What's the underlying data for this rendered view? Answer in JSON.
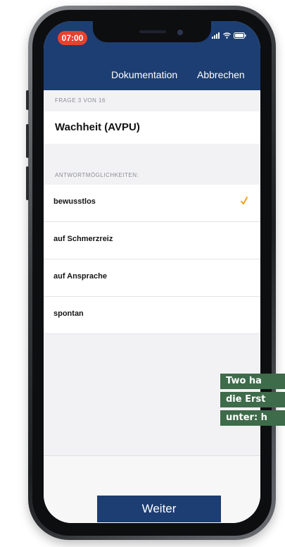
{
  "status_bar": {
    "time": "07:00",
    "icons": "ıll ᯤ ▬"
  },
  "nav": {
    "title": "Dokumentation",
    "cancel": "Abbrechen"
  },
  "question": {
    "counter": "FRAGE 3 VON 16",
    "title": "Wachheit (AVPU)"
  },
  "answers_header": "ANTWORTMÖGLICHKEITEN:",
  "answers": [
    {
      "label": "bewusstlos",
      "selected": true
    },
    {
      "label": "auf Schmerzreiz",
      "selected": false
    },
    {
      "label": "auf Ansprache",
      "selected": false
    },
    {
      "label": "spontan",
      "selected": false
    }
  ],
  "footer": {
    "button": "Weiter"
  },
  "caption_lines": [
    "Two ha",
    "die Erst",
    "unter: h"
  ],
  "colors": {
    "navy": "#1d3e72",
    "check": "#f0a020",
    "caption_bg": "#3e6b4a",
    "time_pill": "#e8412e"
  },
  "icons": {
    "check": "checkmark-icon",
    "signal": "signal-icon",
    "wifi": "wifi-icon",
    "battery": "battery-icon"
  }
}
